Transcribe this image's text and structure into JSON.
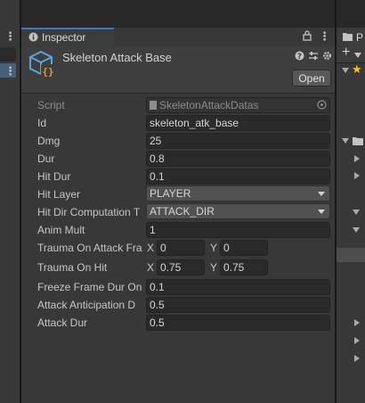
{
  "left_panel": {
    "menu_glyph": "⋮"
  },
  "inspector": {
    "tab_label": "Inspector",
    "title": "Skeleton Attack Base",
    "open_label": "Open",
    "script_label": "Script",
    "script_value": "SkeletonAttackDatas",
    "fields": [
      {
        "label": "Id",
        "value": "skeleton_atk_base"
      },
      {
        "label": "Dmg",
        "value": "25"
      },
      {
        "label": "Dur",
        "value": "0.8"
      },
      {
        "label": "Hit Dur",
        "value": "0.1"
      },
      {
        "label": "Hit Layer",
        "value": "PLAYER"
      },
      {
        "label": "Hit Dir Computation T",
        "value": "ATTACK_DIR"
      },
      {
        "label": "Anim Mult",
        "value": "1"
      },
      {
        "label": "Trauma On Attack Fra",
        "x_label": "X",
        "x": "0",
        "y_label": "Y",
        "y": "0"
      },
      {
        "label": "Trauma On Hit",
        "x_label": "X",
        "x": "0.75",
        "y_label": "Y",
        "y": "0.75"
      },
      {
        "label": "Freeze Frame Dur On",
        "value": "0.1"
      },
      {
        "label": "Attack Anticipation D",
        "value": "0.5"
      },
      {
        "label": "Attack Dur",
        "value": "0.5"
      }
    ]
  },
  "right_panel": {
    "tab_label": "P",
    "plus": "+"
  },
  "colors": {
    "tab_accent": "#3a79bb",
    "selection": "#46607c",
    "star": "#f0c419",
    "icon_blue": "#57a7d9",
    "icon_orange": "#e8953a"
  }
}
